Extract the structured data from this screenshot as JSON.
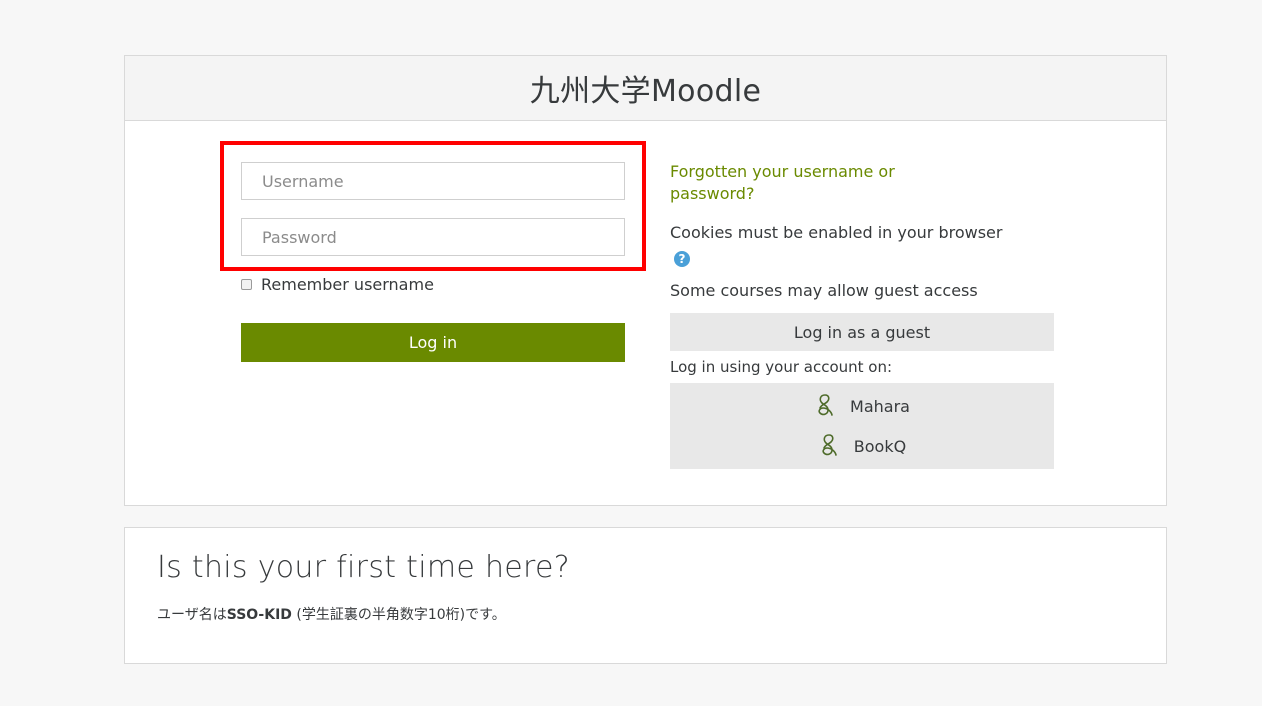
{
  "header": {
    "title_jp": "九州大学",
    "title_en": "Moodle"
  },
  "login_form": {
    "username_placeholder": "Username",
    "password_placeholder": "Password",
    "remember_label": "Remember username",
    "login_label": "Log in"
  },
  "side": {
    "forgot_link": "Forgotten your username or password?",
    "cookies_text": "Cookies must be enabled in your browser",
    "help_icon": "help-icon",
    "guest_info": "Some courses may allow guest access",
    "guest_button": "Log in as a guest",
    "login_using": "Log in using your account on:",
    "identity_providers": [
      {
        "name": "Mahara",
        "icon": "mahara-icon"
      },
      {
        "name": "BookQ",
        "icon": "mahara-icon"
      }
    ]
  },
  "info": {
    "title": "Is this your first time here?",
    "text_prefix": "ユーザ名は",
    "text_bold": "SSO-KID",
    "text_suffix": " (学生証裏の半角数字10桁)です。"
  },
  "colors": {
    "accent": "#6a8a00",
    "highlight": "#ff0000",
    "help": "#4aa0d8",
    "secondary_bg": "#e8e8e8"
  }
}
